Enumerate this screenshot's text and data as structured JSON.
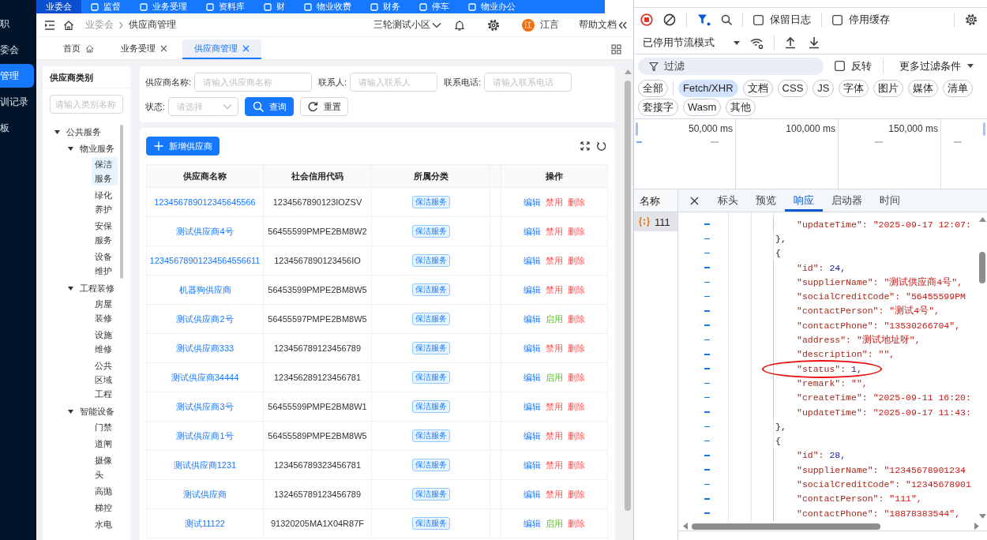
{
  "top_nav": {
    "items": [
      {
        "label": "业委会",
        "selected": true,
        "icon": false
      },
      {
        "label": "监督",
        "selected": false,
        "icon": true
      },
      {
        "label": "业务受理",
        "selected": false,
        "icon": true
      },
      {
        "label": "资料库",
        "selected": false,
        "icon": true
      },
      {
        "label": "财",
        "selected": false,
        "icon": true
      },
      {
        "label": "物业收费",
        "selected": false,
        "icon": true
      },
      {
        "label": "财务",
        "selected": false,
        "icon": true
      },
      {
        "label": "停车",
        "selected": false,
        "icon": true
      },
      {
        "label": "物业办公",
        "selected": false,
        "icon": true
      }
    ]
  },
  "sidebar": {
    "items": [
      {
        "label": "职",
        "selected": false
      },
      {
        "label": "委会",
        "selected": false
      },
      {
        "label": "管理",
        "selected": true
      },
      {
        "label": "训记录",
        "selected": false
      },
      {
        "label": "板",
        "selected": false
      }
    ]
  },
  "header": {
    "breadcrumb": [
      "业委会",
      "供应商管理"
    ],
    "community": "三轮测试小区",
    "user": {
      "avatar": "江",
      "name": "江言"
    },
    "help": "帮助文档"
  },
  "page_tabs": [
    {
      "label": "首页",
      "kind": "home",
      "selected": false
    },
    {
      "label": "业务受理",
      "kind": "closable",
      "selected": false
    },
    {
      "label": "供应商管理",
      "kind": "closable",
      "selected": true
    }
  ],
  "category_panel": {
    "title": "供应商类别",
    "search": {
      "placeholder": "请输入类别名称"
    },
    "tree": [
      {
        "label": "公共服务",
        "expanded": true,
        "children": [
          {
            "label": "物业服务",
            "expanded": true,
            "children": [
              {
                "label": "保洁服务",
                "selected": true
              },
              {
                "label": "绿化养护",
                "selected": false
              },
              {
                "label": "安保服务",
                "selected": false
              },
              {
                "label": "设备维护",
                "selected": false
              }
            ]
          },
          {
            "label": "工程装修",
            "expanded": true,
            "children": [
              {
                "label": "房屋装修",
                "selected": false
              },
              {
                "label": "设施维修",
                "selected": false
              },
              {
                "label": "公共区域工程",
                "selected": false
              }
            ]
          },
          {
            "label": "智能设备",
            "expanded": true,
            "children": [
              {
                "label": "门禁",
                "selected": false
              },
              {
                "label": "道闸",
                "selected": false
              },
              {
                "label": "摄像头",
                "selected": false
              },
              {
                "label": "高抛",
                "selected": false
              },
              {
                "label": "梯控",
                "selected": false
              },
              {
                "label": "水电",
                "selected": false
              }
            ]
          }
        ]
      }
    ]
  },
  "search_form": {
    "fields": [
      {
        "label": "供应商名称:",
        "placeholder": "请输入供应商名称",
        "kind": "input"
      },
      {
        "label": "联系人:",
        "placeholder": "请输入联系人",
        "kind": "input"
      },
      {
        "label": "联系电话:",
        "placeholder": "请输入联系电话",
        "kind": "input"
      },
      {
        "label": "状态:",
        "placeholder": "请选择",
        "kind": "select"
      }
    ],
    "buttons": [
      {
        "label": "查询",
        "kind": "search"
      },
      {
        "label": "重置",
        "kind": "reset"
      }
    ]
  },
  "table": {
    "add_button": "新增供应商",
    "columns": [
      "供应商名称",
      "社会信用代码",
      "所属分类",
      "操作"
    ],
    "rows": [
      {
        "name": "123456789012345645566",
        "credit_code": "1234567890123IOZSV",
        "category": "保洁服务",
        "actions": [
          {
            "label": "编辑",
            "kind": "edit"
          },
          {
            "label": "禁用",
            "kind": "disable"
          },
          {
            "label": "删除",
            "kind": "delete"
          }
        ]
      },
      {
        "name": "测试供应商4号",
        "credit_code": "56455599PMPE2BM8W2",
        "category": "保洁服务",
        "actions": [
          {
            "label": "编辑",
            "kind": "edit"
          },
          {
            "label": "禁用",
            "kind": "disable"
          },
          {
            "label": "删除",
            "kind": "delete"
          }
        ]
      },
      {
        "name": "12345678901234564556611",
        "credit_code": "1234567890123456IO",
        "category": "保洁服务",
        "actions": [
          {
            "label": "编辑",
            "kind": "edit"
          },
          {
            "label": "禁用",
            "kind": "disable"
          },
          {
            "label": "删除",
            "kind": "delete"
          }
        ]
      },
      {
        "name": "机器狗供应商",
        "credit_code": "56453599PMPE2BM8W5",
        "category": "保洁服务",
        "actions": [
          {
            "label": "编辑",
            "kind": "edit"
          },
          {
            "label": "禁用",
            "kind": "disable"
          },
          {
            "label": "删除",
            "kind": "delete"
          }
        ]
      },
      {
        "name": "测试供应商2号",
        "credit_code": "56455597PMPE2BM8W5",
        "category": "保洁服务",
        "actions": [
          {
            "label": "编辑",
            "kind": "edit"
          },
          {
            "label": "启用",
            "kind": "enable"
          },
          {
            "label": "删除",
            "kind": "delete"
          }
        ]
      },
      {
        "name": "测试供应商333",
        "credit_code": "123456789123456789",
        "category": "保洁服务",
        "actions": [
          {
            "label": "编辑",
            "kind": "edit"
          },
          {
            "label": "禁用",
            "kind": "disable"
          },
          {
            "label": "删除",
            "kind": "delete"
          }
        ]
      },
      {
        "name": "测试供应商34444",
        "credit_code": "123456289123456781",
        "category": "保洁服务",
        "actions": [
          {
            "label": "编辑",
            "kind": "edit"
          },
          {
            "label": "启用",
            "kind": "enable"
          },
          {
            "label": "删除",
            "kind": "delete"
          }
        ]
      },
      {
        "name": "测试供应商3号",
        "credit_code": "56455599PMPE2BM8W1",
        "category": "保洁服务",
        "actions": [
          {
            "label": "编辑",
            "kind": "edit"
          },
          {
            "label": "禁用",
            "kind": "disable"
          },
          {
            "label": "删除",
            "kind": "delete"
          }
        ]
      },
      {
        "name": "测试供应商1号",
        "credit_code": "56455589PMPE2BM8W5",
        "category": "保洁服务",
        "actions": [
          {
            "label": "编辑",
            "kind": "edit"
          },
          {
            "label": "禁用",
            "kind": "disable"
          },
          {
            "label": "删除",
            "kind": "delete"
          }
        ]
      },
      {
        "name": "测试供应商1231",
        "credit_code": "123456789323456781",
        "category": "保洁服务",
        "actions": [
          {
            "label": "编辑",
            "kind": "edit"
          },
          {
            "label": "禁用",
            "kind": "disable"
          },
          {
            "label": "删除",
            "kind": "delete"
          }
        ]
      },
      {
        "name": "测试供应商",
        "credit_code": "132465789123456789",
        "category": "保洁服务",
        "actions": [
          {
            "label": "编辑",
            "kind": "edit"
          },
          {
            "label": "禁用",
            "kind": "disable"
          },
          {
            "label": "删除",
            "kind": "delete"
          }
        ]
      },
      {
        "name": "测试11122",
        "credit_code": "91320205MA1X04R87F",
        "category": "保洁服务",
        "actions": [
          {
            "label": "编辑",
            "kind": "edit"
          },
          {
            "label": "启用",
            "kind": "enable"
          },
          {
            "label": "删除",
            "kind": "delete"
          }
        ]
      }
    ]
  },
  "devtools": {
    "toolbar": {
      "checkboxes": [
        {
          "label": "保留日志",
          "checked": false
        },
        {
          "label": "停用缓存",
          "checked": false
        }
      ],
      "throttling": "已停用节流模式"
    },
    "filter": {
      "placeholder": "过滤",
      "invert": {
        "label": "反转",
        "checked": false
      },
      "more_filters": "更多过滤条件"
    },
    "type_filters": [
      {
        "label": "全部",
        "selected": false
      },
      {
        "label": "Fetch/XHR",
        "selected": true
      },
      {
        "label": "文档",
        "selected": false
      },
      {
        "label": "CSS",
        "selected": false
      },
      {
        "label": "JS",
        "selected": false
      },
      {
        "label": "字体",
        "selected": false
      },
      {
        "label": "图片",
        "selected": false
      },
      {
        "label": "媒体",
        "selected": false
      },
      {
        "label": "清单",
        "selected": false
      },
      {
        "label": "套接字",
        "selected": false
      },
      {
        "label": "Wasm",
        "selected": false
      },
      {
        "label": "其他",
        "selected": false
      }
    ],
    "overview": {
      "ticks": [
        "50,000 ms",
        "100,000 ms",
        "150,000 ms"
      ]
    },
    "requests": {
      "header": "名称",
      "items": [
        {
          "name": "111",
          "selected": true
        }
      ]
    },
    "detail_tabs": [
      {
        "label": "标头",
        "selected": false
      },
      {
        "label": "预览",
        "selected": false
      },
      {
        "label": "响应",
        "selected": true
      },
      {
        "label": "启动器",
        "selected": false
      },
      {
        "label": "时间",
        "selected": false
      }
    ],
    "response": {
      "blocks": [
        {
          "entries": [
            {
              "key": "\"updateTime\":",
              "value": "\"2025-09-17 12:07:",
              "kind": "string",
              "circled": false
            }
          ],
          "close": "},"
        },
        {
          "open": "{",
          "entries": [
            {
              "key": "\"id\":",
              "value": "24,",
              "kind": "number",
              "circled": false
            },
            {
              "key": "\"supplierName\":",
              "value": "\"测试供应商4号\",",
              "kind": "string",
              "circled": false
            },
            {
              "key": "\"socialCreditCode\":",
              "value": "\"56455599PM",
              "kind": "string",
              "circled": false
            },
            {
              "key": "\"contactPerson\":",
              "value": "\"测试4号\",",
              "kind": "string",
              "circled": false
            },
            {
              "key": "\"contactPhone\":",
              "value": "\"13530266704\",",
              "kind": "string",
              "circled": false
            },
            {
              "key": "\"address\":",
              "value": "\"测试地址呀\",",
              "kind": "string",
              "circled": false
            },
            {
              "key": "\"description\":",
              "value": "\"\",",
              "kind": "string",
              "circled": false
            },
            {
              "key": "\"status\":",
              "value": "1,",
              "kind": "number",
              "circled": true
            },
            {
              "key": "\"remark\":",
              "value": "\"\",",
              "kind": "string",
              "circled": false
            },
            {
              "key": "\"createTime\":",
              "value": "\"2025-09-11 16:20:",
              "kind": "string",
              "circled": false
            },
            {
              "key": "\"updateTime\":",
              "value": "\"2025-09-17 11:43:",
              "kind": "string",
              "circled": false
            }
          ],
          "close": "},"
        },
        {
          "open": "{",
          "entries": [
            {
              "key": "\"id\":",
              "value": "28,",
              "kind": "number",
              "circled": false
            },
            {
              "key": "\"supplierName\":",
              "value": "\"12345678901234",
              "kind": "string",
              "circled": false
            },
            {
              "key": "\"socialCreditCode\":",
              "value": "\"12345678901",
              "kind": "string",
              "circled": false
            },
            {
              "key": "\"contactPerson\":",
              "value": "\"111\",",
              "kind": "string",
              "circled": false
            },
            {
              "key": "\"contactPhone\":",
              "value": "\"18878383544\",",
              "kind": "string",
              "circled": false
            }
          ]
        }
      ]
    }
  }
}
